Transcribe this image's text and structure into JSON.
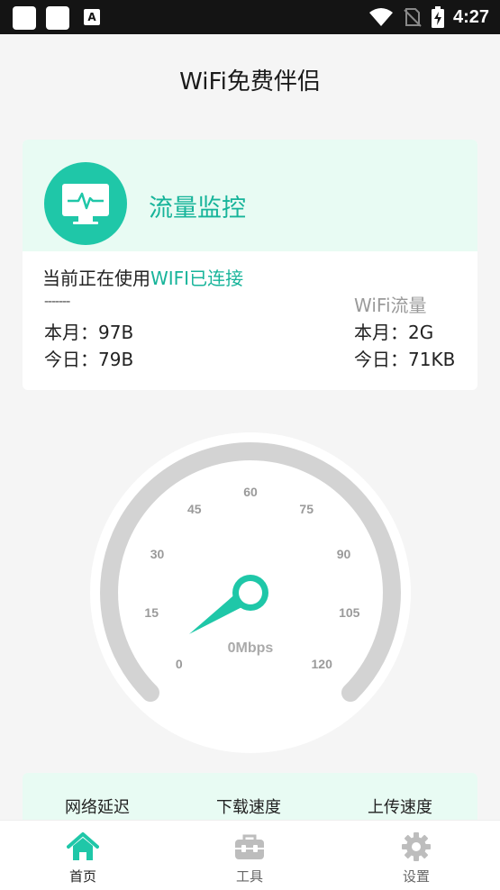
{
  "status_bar": {
    "time": "4:27",
    "notification_glyph": "A"
  },
  "app": {
    "title": "WiFi免费伴侣"
  },
  "monitor_card": {
    "title": "流量监控",
    "usage_prefix": "当前正在使用",
    "usage_status": "WIFI已连接",
    "placeholder_dashes": "-------",
    "left_month": "本月：97B",
    "left_today": "今日：79B",
    "wifi_label": "WiFi流量",
    "right_month": "本月：2G",
    "right_today": "今日：71KB"
  },
  "gauge": {
    "ticks": [
      "0",
      "15",
      "30",
      "45",
      "60",
      "75",
      "90",
      "105",
      "120"
    ],
    "speed_text": "0Mbps",
    "value": 0,
    "accent": "#1fc7a8"
  },
  "info_strip": {
    "latency_label": "网络延迟",
    "download_label": "下载速度",
    "upload_label": "上传速度"
  },
  "nav": {
    "items": [
      {
        "label": "首页",
        "icon": "home-icon",
        "active": true
      },
      {
        "label": "工具",
        "icon": "toolbox-icon",
        "active": false
      },
      {
        "label": "设置",
        "icon": "gear-icon",
        "active": false
      }
    ]
  },
  "colors": {
    "accent": "#1fc7a8",
    "accent_text": "#17b49a",
    "card_header_bg": "#e8fbf3",
    "status_bar_bg": "#141414"
  }
}
